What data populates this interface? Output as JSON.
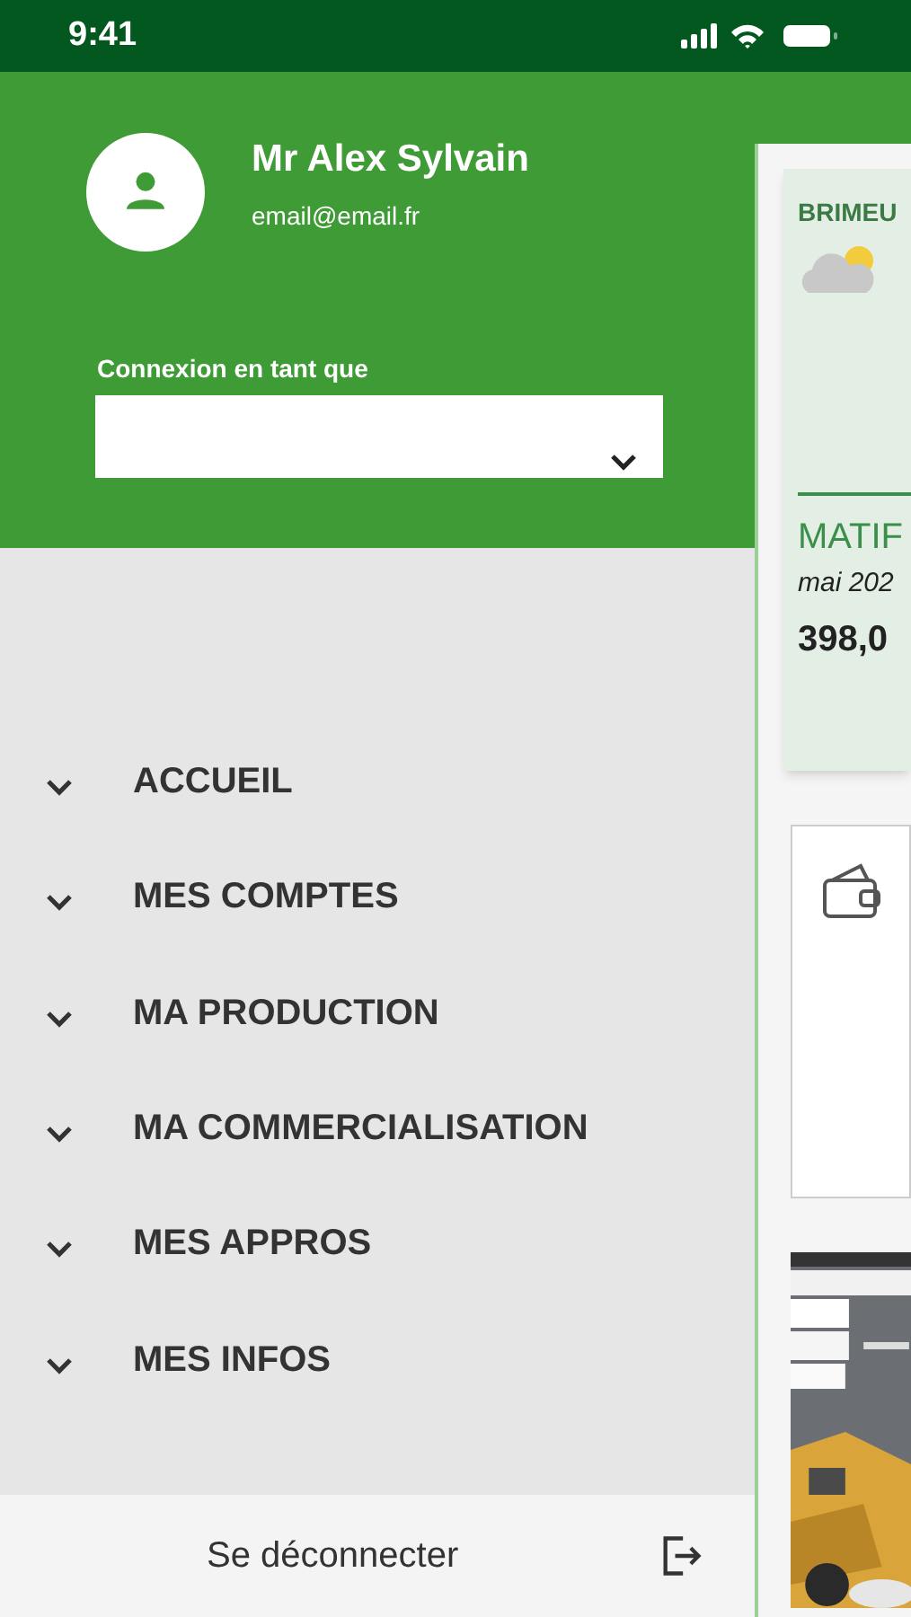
{
  "status_bar": {
    "time": "9:41"
  },
  "drawer": {
    "user": {
      "name": "Mr Alex Sylvain",
      "email": "email@email.fr"
    },
    "connexion": {
      "label": "Connexion en tant que"
    },
    "menu": [
      {
        "label": "ACCUEIL",
        "expanded": false
      },
      {
        "label": "MES COMPTES",
        "expanded": false
      },
      {
        "label": "MA PRODUCTION",
        "expanded": false
      },
      {
        "label": "MA COMMERCIALISATION",
        "expanded": false
      },
      {
        "label": "MES APPROS",
        "expanded": false
      },
      {
        "label": "MES INFOS",
        "expanded": false
      }
    ],
    "logout": "Se déconnecter"
  },
  "background": {
    "weather_card": {
      "location": "BRIMEU",
      "matif_title": "MATIF",
      "matif_date": "mai 202",
      "matif_price": "398,0"
    },
    "accounts_card": {
      "kind": "wallet"
    }
  }
}
